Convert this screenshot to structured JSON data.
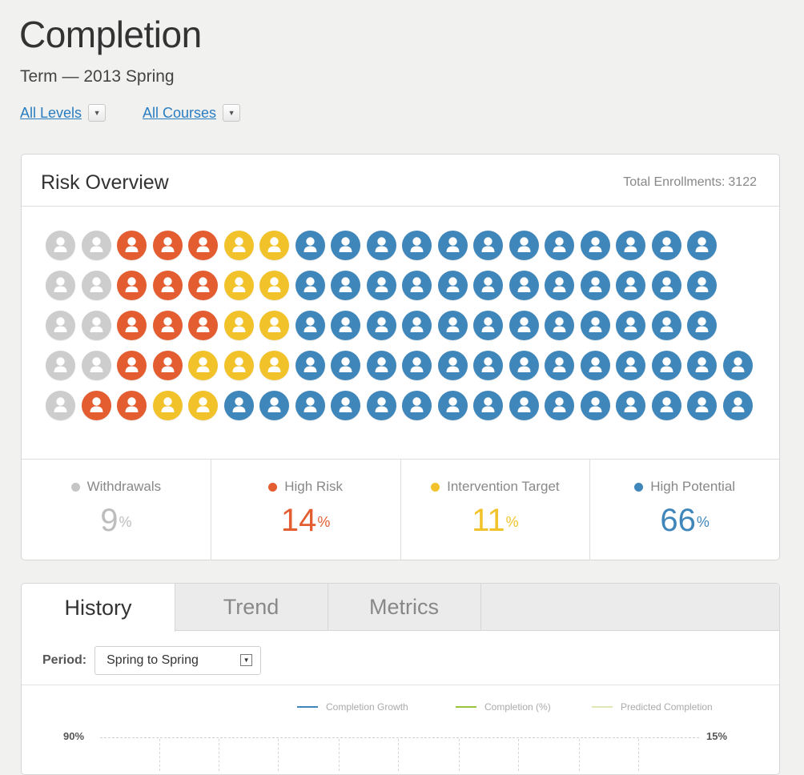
{
  "header": {
    "title": "Completion",
    "subtitle": "Term — 2013 Spring",
    "filters": [
      {
        "label": "All Levels"
      },
      {
        "label": "All Courses"
      }
    ]
  },
  "risk_overview": {
    "title": "Risk Overview",
    "total_label": "Total Enrollments:",
    "total_value": "3122",
    "icon_grid": [
      "wwhhhiipppppppppppp",
      "wwhhhiipppppppppppp",
      "wwhhhiipppppppppppp",
      "wwhhiiippppppppppppp",
      "whhiippppppppppppppp"
    ],
    "categories": [
      {
        "key": "w",
        "label": "Withdrawals",
        "value": "9",
        "unit": "%",
        "color": "#c5c5c5"
      },
      {
        "key": "h",
        "label": "High Risk",
        "value": "14",
        "unit": "%",
        "color": "#e35d30"
      },
      {
        "key": "i",
        "label": "Intervention Target",
        "value": "11",
        "unit": "%",
        "color": "#f2c22b"
      },
      {
        "key": "p",
        "label": "High Potential",
        "value": "66",
        "unit": "%",
        "color": "#3f86bb"
      }
    ]
  },
  "tabs": [
    {
      "label": "History",
      "active": true
    },
    {
      "label": "Trend",
      "active": false
    },
    {
      "label": "Metrics",
      "active": false
    }
  ],
  "period": {
    "label": "Period:",
    "selected": "Spring to Spring"
  },
  "chart_data": {
    "type": "line",
    "series": [
      {
        "name": "Completion Growth",
        "color": "#3f86bb"
      },
      {
        "name": "Completion (%)",
        "color": "#9ac53a"
      },
      {
        "name": "Predicted Completion",
        "color": "#dfe8b4"
      }
    ],
    "y_left_tick": "90%",
    "y_right_tick": "15%"
  }
}
